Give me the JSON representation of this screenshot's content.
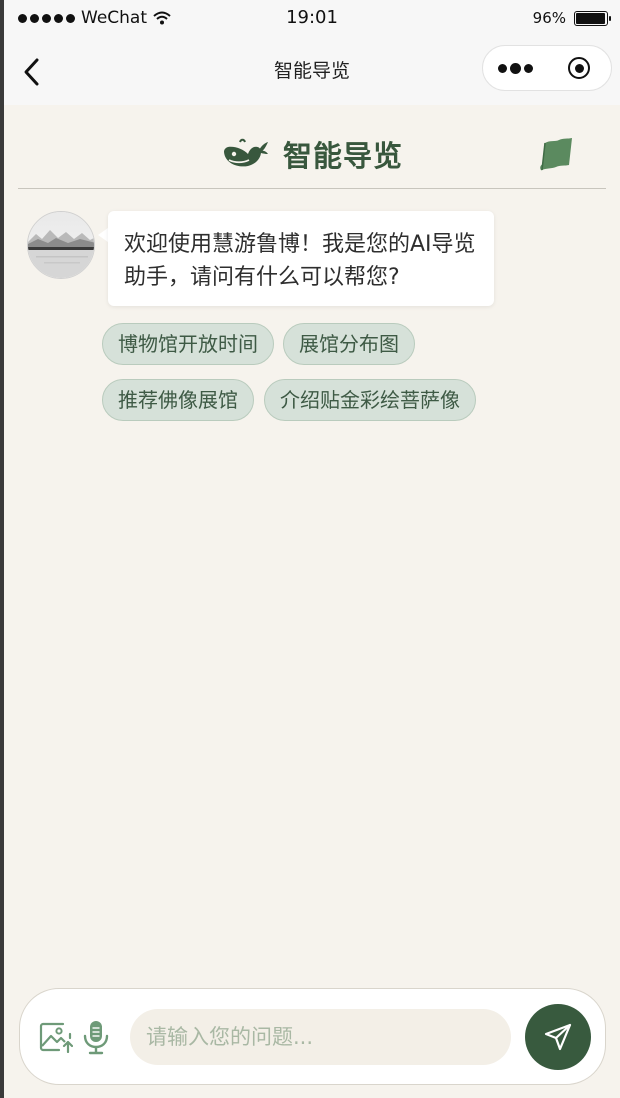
{
  "status_bar": {
    "carrier": "WeChat",
    "time": "19:01",
    "battery_percent": "96%",
    "battery_level": 0.96
  },
  "nav": {
    "title": "智能导览",
    "back_icon": "chevron-left-icon",
    "more_icon": "more-dots-icon",
    "close_icon": "target-close-icon"
  },
  "header": {
    "title": "智能导览",
    "logo_icon": "whale-icon",
    "map_icon": "map-icon",
    "accent_color": "#38573d"
  },
  "chat": {
    "assistant_message": "欢迎使用慧游鲁博！我是您的AI导览助手，请问有什么可以帮您?",
    "avatar_icon": "landscape-avatar",
    "suggestions": [
      "博物馆开放时间",
      "展馆分布图",
      "推荐佛像展馆",
      "介绍贴金彩绘菩萨像"
    ],
    "chip_color": "#d6e1d9"
  },
  "input": {
    "placeholder": "请输入您的问题...",
    "value": "",
    "image_icon": "image-upload-icon",
    "mic_icon": "microphone-icon",
    "send_icon": "send-paper-plane-icon",
    "send_color": "#385a3e"
  }
}
